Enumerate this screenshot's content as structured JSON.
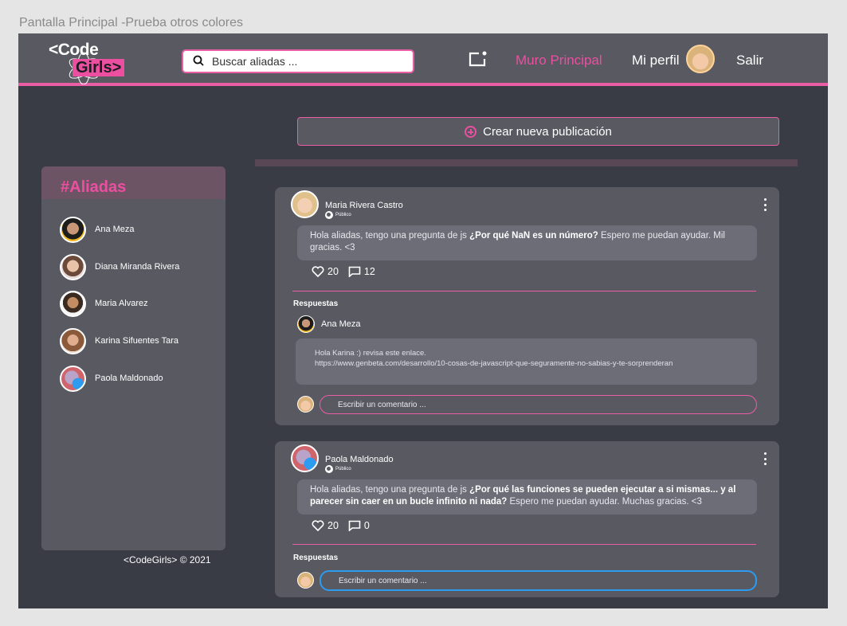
{
  "frame_title": "Pantalla Principal -Prueba otros colores",
  "nav": {
    "logo_top": "<Code",
    "logo_bottom": "Girls>",
    "search_placeholder": "Buscar aliadas ...",
    "new_post_icon": "new-post-icon",
    "links": [
      "Muro Principal",
      "Mi perfil",
      "Salir"
    ],
    "active_link": "Muro Principal"
  },
  "new_post_label": "Crear nueva publicación",
  "sidebar": {
    "title": "#Aliadas",
    "allies": [
      "Ana Meza",
      "Diana Miranda Rivera",
      "Maria Alvarez",
      "Karina Sifuentes Tara",
      "Paola Maldonado"
    ]
  },
  "footer": "<CodeGirls> © 2021",
  "posts": [
    {
      "author": "Maria Rivera Castro",
      "visibility": "Público",
      "text_before": "Hola aliadas, tengo una pregunta de js ",
      "text_bold": "¿Por qué NaN es un número?",
      "text_after": " Espero me puedan ayudar. Mil gracias. <3",
      "likes": "20",
      "comments": "12",
      "responses_label": "Respuestas",
      "reply": {
        "author": "Ana Meza",
        "line1": "Hola Karina :) revisa este enlace.",
        "line2": "https://www.genbeta.com/desarrollo/10-cosas-de-javascript-que-seguramente-no-sabias-y-te-sorprenderan"
      },
      "comment_placeholder": "Escribir un comentario ..."
    },
    {
      "author": "Paola Maldonado",
      "visibility": "Público",
      "text_before": "Hola aliadas, tengo una pregunta de js ",
      "text_bold": "¿Por qué las funciones se pueden ejecutar a si mismas... y al parecer sin caer en un bucle infinito ni nada?",
      "text_after": " Espero me puedan ayudar. Muchas gracias. <3",
      "likes": "20",
      "comments": "0",
      "responses_label": "Respuestas",
      "comment_placeholder": "Escribir un comentario ..."
    }
  ],
  "colors": {
    "accent": "#ec4fa0",
    "background": "#393b45",
    "panel": "#595962",
    "focus": "#2d9bf0"
  }
}
